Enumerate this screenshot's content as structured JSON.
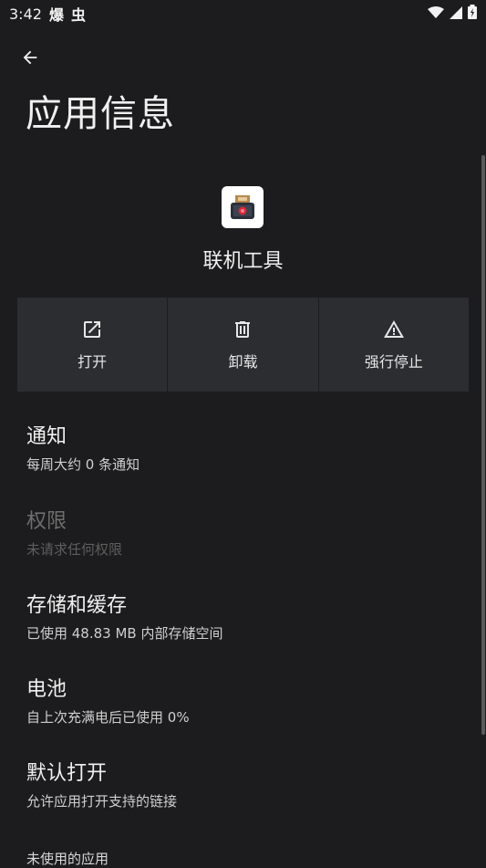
{
  "status_bar": {
    "time": "3:42",
    "notif_1": "爆",
    "notif_2": "虫",
    "wifi_icon": "wifi-icon",
    "signal_icon": "signal-icon",
    "battery_icon": "battery-charging-icon"
  },
  "header": {
    "back_icon": "arrow-left-icon",
    "title": "应用信息"
  },
  "app": {
    "name": "联机工具",
    "icon": "app-icon"
  },
  "actions": [
    {
      "label": "打开",
      "icon": "open-external-icon"
    },
    {
      "label": "卸载",
      "icon": "trash-icon"
    },
    {
      "label": "强行停止",
      "icon": "warning-icon"
    }
  ],
  "settings": [
    {
      "title": "通知",
      "subtitle": "每周大约 0 条通知",
      "enabled": true
    },
    {
      "title": "权限",
      "subtitle": "未请求任何权限",
      "enabled": false
    },
    {
      "title": "存储和缓存",
      "subtitle": "已使用 48.83 MB 内部存储空间",
      "enabled": true
    },
    {
      "title": "电池",
      "subtitle": "自上次充满电后已使用 0%",
      "enabled": true
    },
    {
      "title": "默认打开",
      "subtitle": "允许应用打开支持的链接",
      "enabled": true
    }
  ],
  "section_partial": "未使用的应用",
  "colors": {
    "background": "#1c1c1e",
    "button_bg": "#2b2d30",
    "text_primary": "#f0f0f0",
    "text_disabled": "#6e6e6e"
  }
}
